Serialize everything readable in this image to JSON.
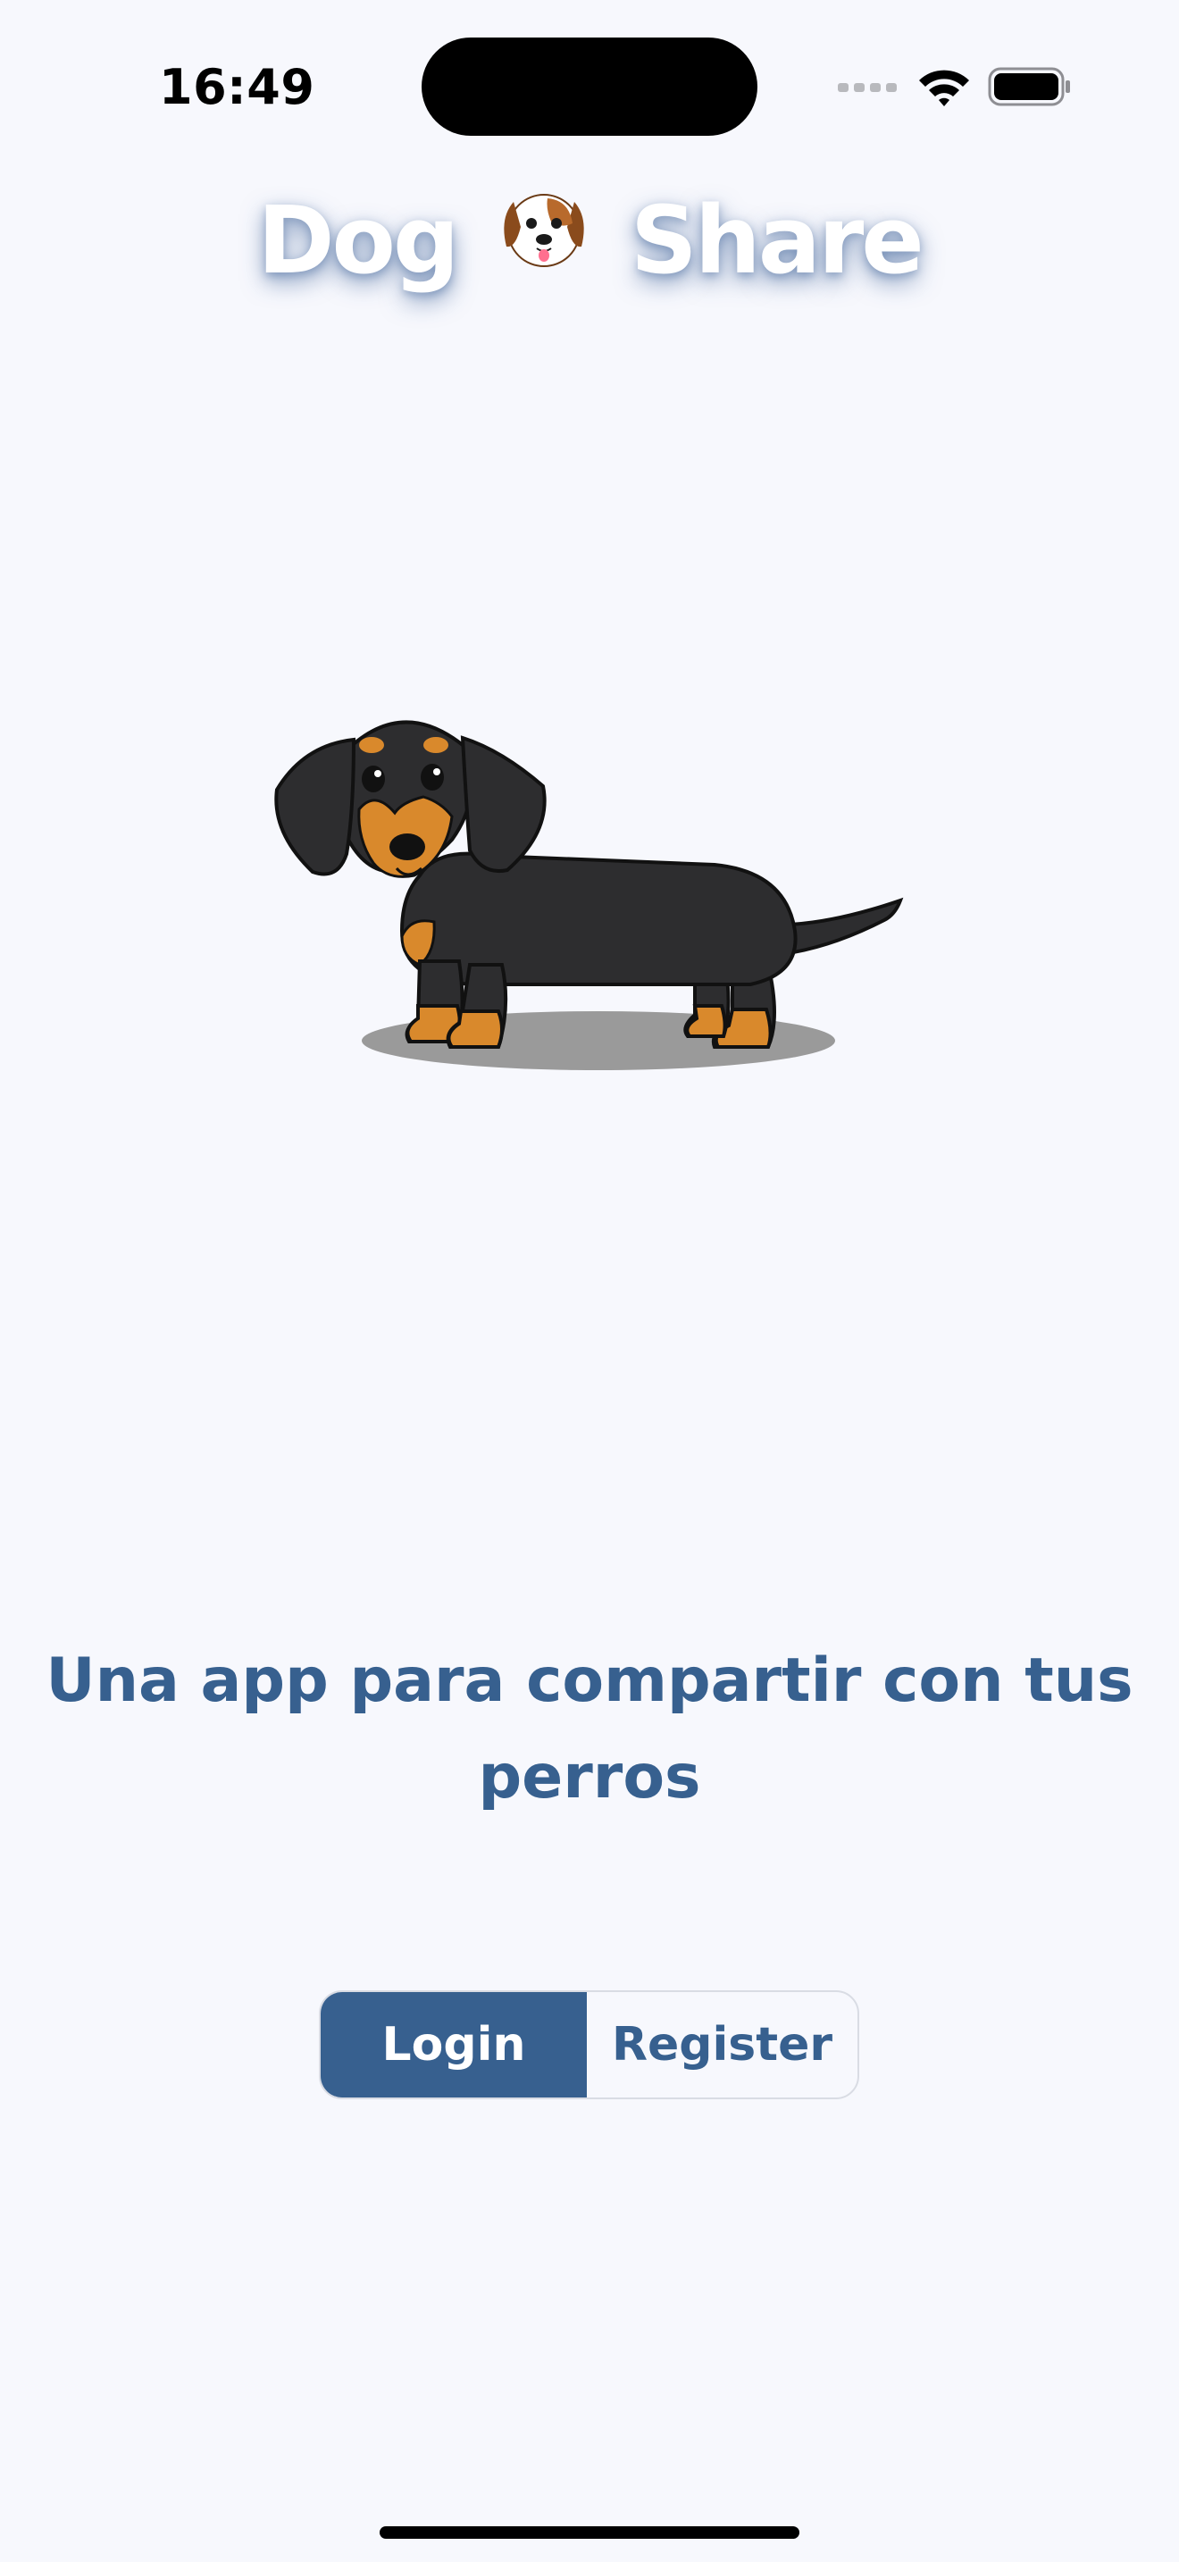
{
  "status_bar": {
    "time": "16:49"
  },
  "header": {
    "title_left": "Dog",
    "title_right": "Share",
    "title_icon": "dog-face-emoji"
  },
  "hero": {
    "illustration": "dachshund-illustration"
  },
  "tagline": "Una app para compartir con tus perros",
  "auth": {
    "login_label": "Login",
    "register_label": "Register",
    "selected": "Login"
  },
  "colors": {
    "background": "#f7f8fd",
    "accent": "#37608f",
    "text_on_accent": "#ffffff"
  }
}
